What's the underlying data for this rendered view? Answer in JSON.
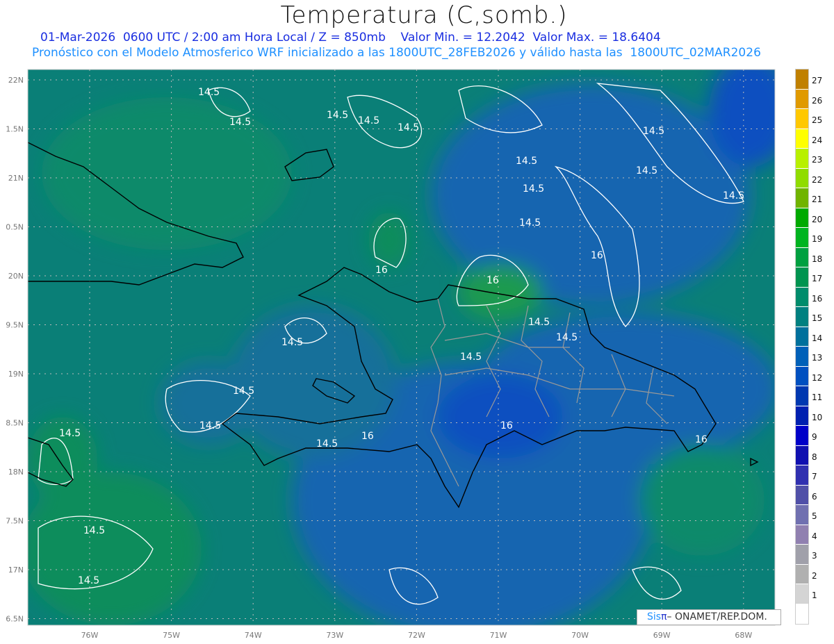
{
  "header": {
    "title": "Temperatura (C,somb.)",
    "subtitle1": "01-Mar-2026  0600 UTC / 2:00 am Hora Local / Z = 850mb    Valor Min. = 12.2042  Valor Max. = 18.6404",
    "subtitle2": "Pronóstico con el Modelo Atmosferico WRF inicializado a las 1800UTC_28FEB2026 y válido hasta las  1800UTC_02MAR2026"
  },
  "map": {
    "variable": "Temperatura 850mb",
    "value_min": 12.2042,
    "value_max": 18.6404,
    "lon_labels": [
      "76W",
      "75W",
      "74W",
      "73W",
      "72W",
      "71W",
      "70W",
      "69W",
      "68W"
    ],
    "lat_labels": [
      "22N",
      "1.5N",
      "21N",
      "0.5N",
      "20N",
      "9.5N",
      "19N",
      "8.5N",
      "18N",
      "7.5N",
      "17N",
      "6.5N"
    ],
    "contour_labels": [
      "14.5",
      "14.5",
      "14.5",
      "14.5",
      "14.5",
      "14.5",
      "14.5",
      "14.5",
      "14.5",
      "14.5",
      "16",
      "14.5",
      "16",
      "16",
      "14.5",
      "14.5",
      "14.5",
      "14.5",
      "14.5",
      "14.5",
      "14.5",
      "16",
      "16",
      "16",
      "14.5",
      "14.5",
      "14.5"
    ],
    "fill_colors": {
      "base": "#0a7f77",
      "green": "#118d5c",
      "blue": "#1465b0",
      "deep_blue": "#1050c0"
    }
  },
  "colorbar": {
    "labels": [
      "27",
      "26",
      "25",
      "24",
      "23",
      "22",
      "21",
      "20",
      "19",
      "18",
      "17",
      "16",
      "15",
      "14",
      "13",
      "12",
      "11",
      "10",
      "9",
      "8",
      "7",
      "6",
      "5",
      "4",
      "3",
      "2",
      "1"
    ],
    "colors": [
      "#c08000",
      "#e09a00",
      "#ffc800",
      "#ffff00",
      "#b8f000",
      "#90dc00",
      "#70b400",
      "#00aa00",
      "#00b420",
      "#00a040",
      "#009450",
      "#008c6c",
      "#008080",
      "#00709c",
      "#0060b8",
      "#0050c0",
      "#0038b0",
      "#0020b0",
      "#0000c8",
      "#1010b0",
      "#3030b0",
      "#5050a8",
      "#7070b0",
      "#9080b0",
      "#a0a0aa",
      "#b0b0b0",
      "#d4d4d4",
      "#ffffff"
    ]
  },
  "credit": {
    "sis": "Sis",
    "pi": "π",
    "rest": "– ONAMET/REP.DOM."
  }
}
